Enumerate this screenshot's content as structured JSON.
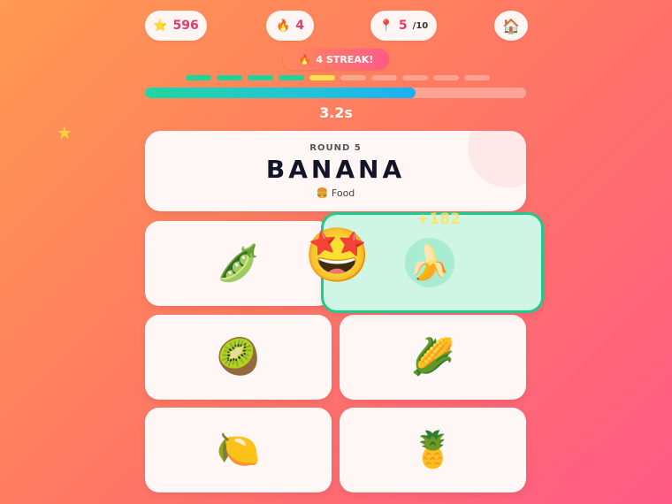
{
  "hud": {
    "score": {
      "icon": "star-icon",
      "glyph": "⭐",
      "value": "596"
    },
    "lives": {
      "icon": "flame-icon",
      "glyph": "🔥",
      "value": "4"
    },
    "round": {
      "icon": "pin-icon",
      "glyph": "📍",
      "value": "5",
      "total": "/10"
    },
    "home": {
      "icon": "home-icon",
      "glyph": "🏠"
    }
  },
  "streak": {
    "icon": "flame-icon",
    "glyph": "🔥",
    "label": "4 STREAK!"
  },
  "progress": {
    "total_rounds": 10,
    "completed": 4,
    "current": 5
  },
  "timer": {
    "label": "3.2s",
    "fraction_remaining": 0.71
  },
  "prompt": {
    "round_label": "ROUND 5",
    "word": "BANANA",
    "category_icon": "🍔",
    "category": "Food"
  },
  "options": [
    {
      "name": "pea-pod-option",
      "glyph": "🫛",
      "correct": false
    },
    {
      "name": "banana-option",
      "glyph": "🍌",
      "correct": true
    },
    {
      "name": "kiwi-option",
      "glyph": "🥝",
      "correct": false
    },
    {
      "name": "corn-option",
      "glyph": "🌽",
      "correct": false
    },
    {
      "name": "lemon-option",
      "glyph": "🍋",
      "correct": false
    },
    {
      "name": "pineapple-option",
      "glyph": "🍍",
      "correct": false
    }
  ],
  "feedback": {
    "points": "+182",
    "reaction": "🤩",
    "sparkle": "★"
  },
  "colors": {
    "accent_pink": "#e23b6d",
    "correct_green": "#21c98c",
    "progress_done": "#1fd49a",
    "progress_current": "#ffe14d"
  }
}
